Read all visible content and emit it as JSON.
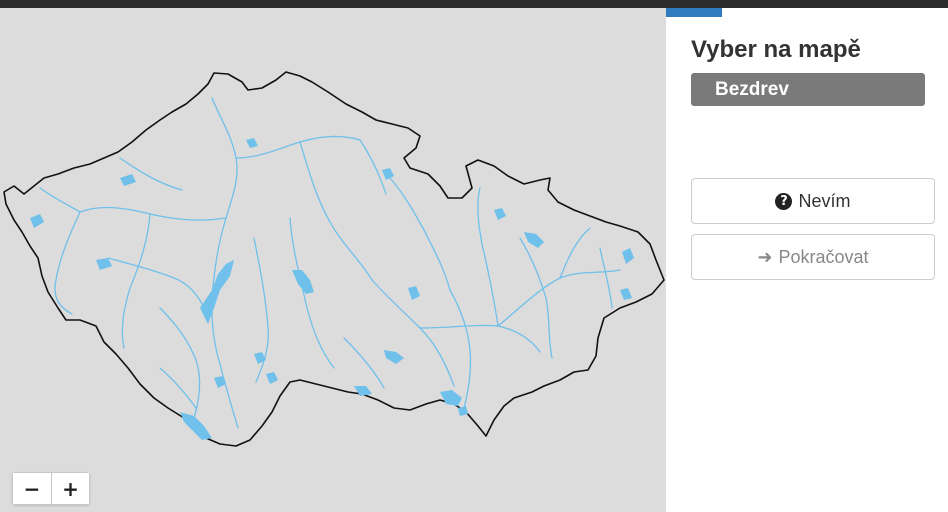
{
  "map": {
    "country_fill": "#dcdcdc",
    "border_color": "#111111",
    "river_color": "#6fc0ea",
    "lake_color": "#6fc0ea",
    "zoom_out_label": "−",
    "zoom_in_label": "+"
  },
  "panel": {
    "title": "Vyber na mapě",
    "target_name": "Bezdrev",
    "dont_know_label": "Nevím",
    "continue_label": "Pokračovat",
    "accent": "#2f7bbf"
  },
  "icons": {
    "dont_know": "question-circle-icon",
    "continue": "arrow-right-icon"
  }
}
